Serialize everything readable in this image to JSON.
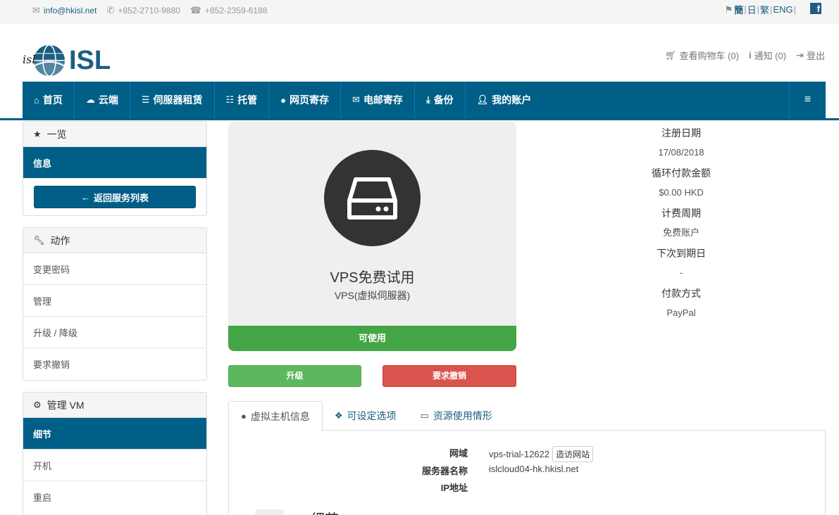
{
  "topbar": {
    "email": "info@hkisl.net",
    "phone": "+852-2710-9880",
    "fax": "+852-2359-6188",
    "lang_simplified": "簡",
    "lang_japanese": "日",
    "lang_traditional": "繁",
    "lang_english": "ENG",
    "facebook": "f"
  },
  "header": {
    "logo_text": "ISL",
    "cart": "查看购物车 (0)",
    "notifications": "通知 (0)",
    "logout": "登出"
  },
  "nav": {
    "home": "首页",
    "cloud": "云端",
    "server_rental": "伺服器租赁",
    "colocation": "托管",
    "web_hosting": "网页寄存",
    "email_hosting": "电邮寄存",
    "backup": "备份",
    "my_account": "我的账户"
  },
  "sidebar": {
    "overview": {
      "title": "一览",
      "items": [
        "信息"
      ],
      "back_button": "返回服务列表"
    },
    "actions": {
      "title": "动作",
      "items": [
        "变更密码",
        "管理",
        "升级 / 降级",
        "要求撤销"
      ]
    },
    "manage_vm": {
      "title": "管理 VM",
      "items": [
        "细节",
        "开机",
        "重启"
      ]
    }
  },
  "product": {
    "name": "VPS免费试用",
    "type": "VPS(虚拟伺服器)",
    "status": "可使用",
    "upgrade_button": "升级",
    "cancel_button": "要求撤销"
  },
  "info": {
    "reg_date_label": "注册日期",
    "reg_date": "17/08/2018",
    "recurring_label": "循环付款金额",
    "recurring": "$0.00 HKD",
    "billing_cycle_label": "计费周期",
    "billing_cycle": "免费账户",
    "next_due_label": "下次到期日",
    "next_due": "-",
    "payment_label": "付款方式",
    "payment": "PayPal"
  },
  "tabs": {
    "host_info": "虚拟主机信息",
    "config_options": "可设定选项",
    "resource_usage": "资源使用情形"
  },
  "host": {
    "domain_label": "网域",
    "domain": "vps-trial-12622",
    "visit_button": "造访网站",
    "server_name_label": "服务器名称",
    "server_name": "islcloud04-hk.hkisl.net",
    "ip_label": "IP地址",
    "ip": "",
    "details_title": "细节"
  },
  "colors": {
    "brand": "#005f87",
    "success": "#44a544",
    "upgrade": "#5cb85c",
    "danger": "#d9534f"
  }
}
